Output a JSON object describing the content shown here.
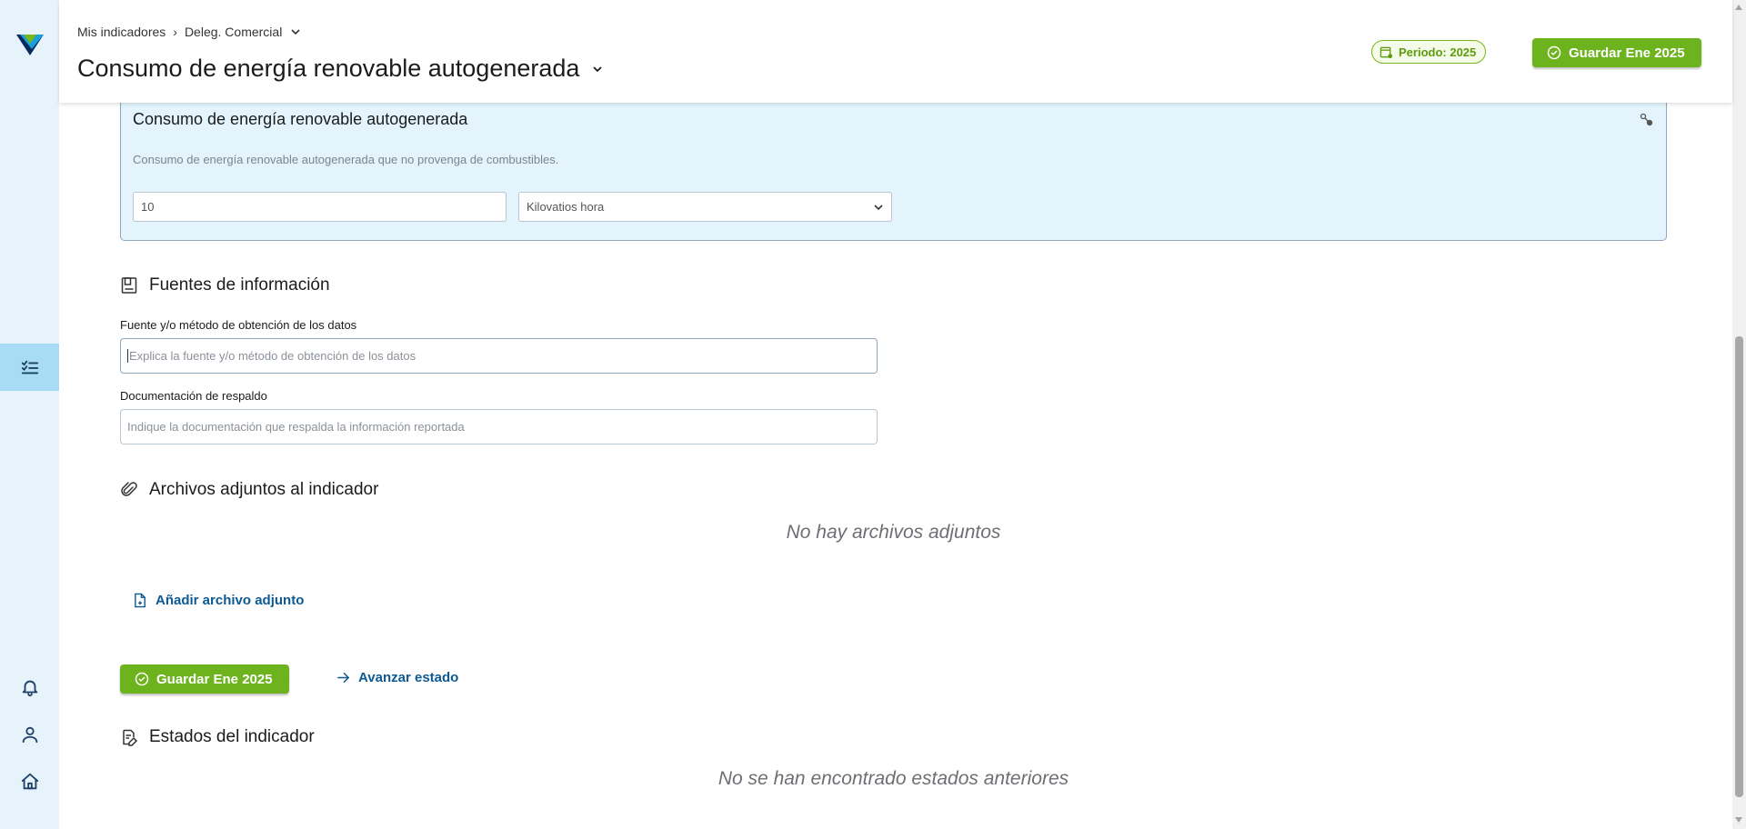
{
  "breadcrumb": {
    "root": "Mis indicadores",
    "current": "Deleg. Comercial"
  },
  "header": {
    "title": "Consumo de energía renovable autogenerada",
    "period_label": "Periodo: 2025",
    "save_label": "Guardar Ene 2025"
  },
  "indicator_card": {
    "title": "Consumo de energía renovable autogenerada",
    "description": "Consumo de energía renovable autogenerada que no provenga de combustibles.",
    "value": "10",
    "unit": "Kilovatios hora"
  },
  "sources": {
    "title": "Fuentes de información",
    "method_label": "Fuente y/o método de obtención de los datos",
    "method_placeholder": "Explica la fuente y/o método de obtención de los datos",
    "docs_label": "Documentación de respaldo",
    "docs_placeholder": "Indique la documentación que respalda la información reportada"
  },
  "attachments": {
    "title": "Archivos adjuntos al indicador",
    "empty": "No hay archivos adjuntos",
    "add_label": "Añadir archivo adjunto"
  },
  "actions": {
    "save_label": "Guardar Ene 2025",
    "advance_label": "Avanzar estado"
  },
  "states": {
    "title": "Estados del indicador",
    "empty": "No se han encontrado estados anteriores"
  },
  "colors": {
    "accent_green": "#6cb31e",
    "link_blue": "#0d5a93",
    "sidebar_bg": "#e6f3fa",
    "card_bg": "#e3f4fc"
  },
  "icons": {
    "logo": "brand-logo-icon",
    "tasks": "checklist-icon",
    "notifications": "bell-icon",
    "profile": "user-icon",
    "home": "home-icon"
  }
}
